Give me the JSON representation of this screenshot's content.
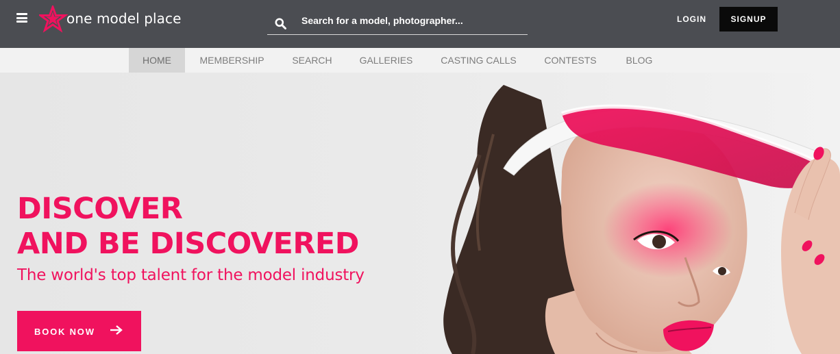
{
  "brand": {
    "logo_text": "one model place",
    "accent_color": "#f0125e"
  },
  "header": {
    "menu_icon": "hamburger-menu-icon",
    "search_icon": "search-icon",
    "search_placeholder": "Search for a model, photographer...",
    "search_value": "",
    "login_label": "LOGIN",
    "signup_label": "SIGNUP"
  },
  "nav": {
    "items": [
      {
        "label": "HOME",
        "active": true
      },
      {
        "label": "MEMBERSHIP",
        "active": false
      },
      {
        "label": "SEARCH",
        "active": false
      },
      {
        "label": "GALLERIES",
        "active": false
      },
      {
        "label": "CASTING CALLS",
        "active": false
      },
      {
        "label": "CONTESTS",
        "active": false
      },
      {
        "label": "BLOG",
        "active": false
      }
    ]
  },
  "hero": {
    "headline_line1": "DISCOVER",
    "headline_line2": "AND BE DISCOVERED",
    "tagline": "The world's top talent for the model industry",
    "cta_label": "BOOK NOW",
    "cta_icon": "arrow-right-icon"
  }
}
